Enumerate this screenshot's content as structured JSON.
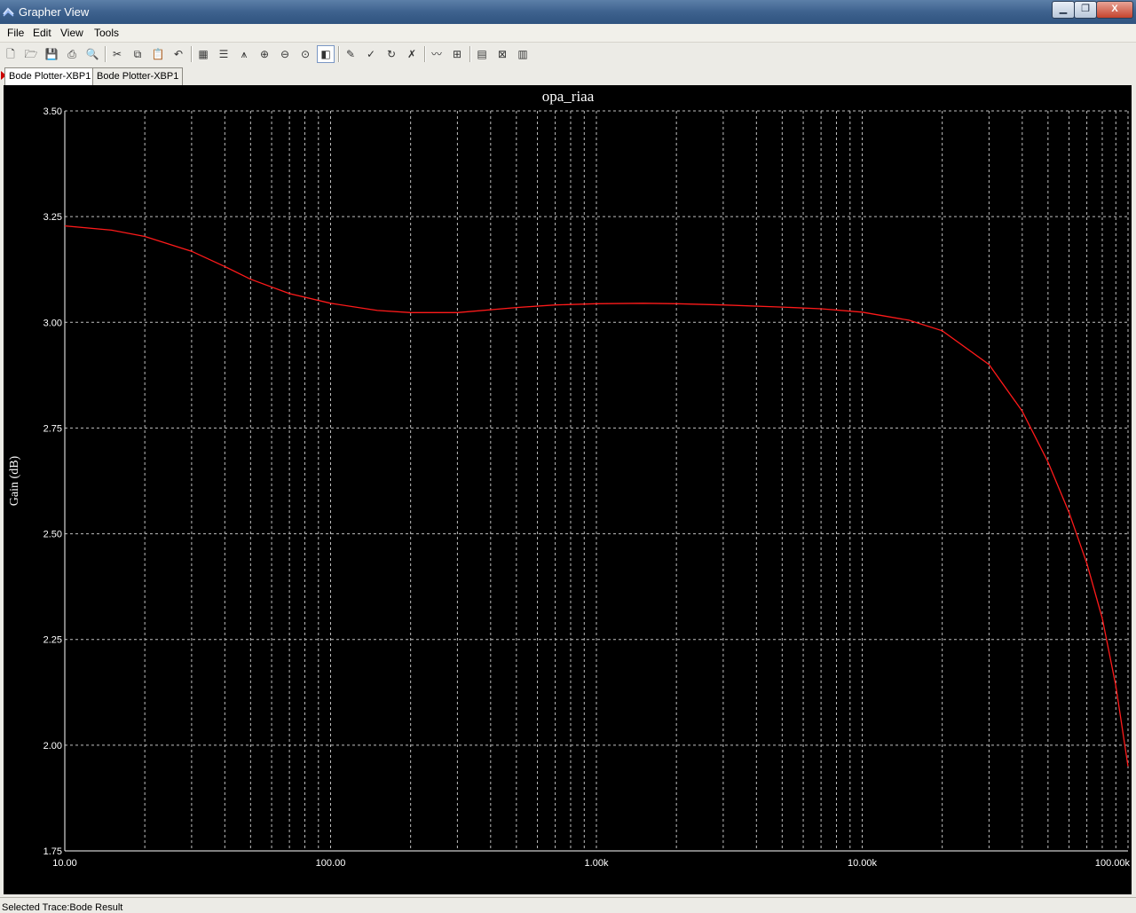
{
  "window": {
    "title": "Grapher View",
    "minimize_label": "▁",
    "maximize_label": "❐",
    "close_label": "X"
  },
  "menu": [
    "File",
    "Edit",
    "View",
    "Tools"
  ],
  "toolbar": [
    {
      "name": "new-icon",
      "glyph": "🗋"
    },
    {
      "name": "open-icon",
      "glyph": "🗁"
    },
    {
      "name": "save-icon",
      "glyph": "💾"
    },
    {
      "name": "print-icon",
      "glyph": "⎙"
    },
    {
      "name": "print-preview-icon",
      "glyph": "🔍"
    },
    {
      "name": "sep"
    },
    {
      "name": "cut-icon",
      "glyph": "✂"
    },
    {
      "name": "copy-icon",
      "glyph": "⧉"
    },
    {
      "name": "paste-icon",
      "glyph": "📋"
    },
    {
      "name": "undo-icon",
      "glyph": "↶"
    },
    {
      "name": "sep"
    },
    {
      "name": "toggle-grid-icon",
      "glyph": "▦"
    },
    {
      "name": "toggle-legend-icon",
      "glyph": "☰"
    },
    {
      "name": "toggle-cursors-icon",
      "glyph": "⩚"
    },
    {
      "name": "zoom-in-icon",
      "glyph": "⊕"
    },
    {
      "name": "zoom-out-icon",
      "glyph": "⊖"
    },
    {
      "name": "zoom-full-icon",
      "glyph": "⊙"
    },
    {
      "name": "reverse-colors-icon",
      "glyph": "◧",
      "pressed": true
    },
    {
      "name": "sep"
    },
    {
      "name": "properties-icon",
      "glyph": "✎"
    },
    {
      "name": "trace-icon",
      "glyph": "✓"
    },
    {
      "name": "reflect-icon",
      "glyph": "↻"
    },
    {
      "name": "pick-icon",
      "glyph": "✗"
    },
    {
      "name": "sep"
    },
    {
      "name": "add-trace-icon",
      "glyph": "〰"
    },
    {
      "name": "overlay-traces-icon",
      "glyph": "⊞"
    },
    {
      "name": "sep"
    },
    {
      "name": "export-excel-icon",
      "glyph": "▤"
    },
    {
      "name": "export-mathcad-icon",
      "glyph": "⊠"
    },
    {
      "name": "export-lvm-icon",
      "glyph": "▥"
    }
  ],
  "tabs": [
    {
      "label": "Bode Plotter-XBP1",
      "active": true
    },
    {
      "label": "Bode Plotter-XBP1",
      "active": false
    }
  ],
  "status": {
    "text": "Selected Trace:Bode Result"
  },
  "colors": {
    "background": "#000000",
    "grid": "#bfbfbf",
    "trace": "#ff1a1a",
    "text": "#ffffff"
  },
  "chart_data": {
    "type": "line",
    "title": "opa_riaa",
    "xlabel": "",
    "ylabel": "Gain (dB)",
    "xscale": "log",
    "xlim": [
      10,
      100000
    ],
    "ylim": [
      1.75,
      3.5
    ],
    "grid": true,
    "x_tick_labels": [
      "10.00",
      "100.00",
      "1.00k",
      "10.00k",
      "100.00k"
    ],
    "y_tick_labels": [
      "3.50",
      "3.25",
      "3.00",
      "2.75",
      "2.50",
      "2.25",
      "2.00",
      "1.75"
    ],
    "series": [
      {
        "color": "#ff1a1a",
        "x": [
          10,
          15,
          20,
          30,
          40,
          50,
          70,
          100,
          150,
          200,
          300,
          500,
          700,
          1000,
          1500,
          2000,
          3000,
          5000,
          7000,
          10000,
          15000,
          20000,
          30000,
          40000,
          50000,
          60000,
          70000,
          80000,
          90000,
          100000
        ],
        "y": [
          3.228,
          3.218,
          3.203,
          3.168,
          3.132,
          3.102,
          3.068,
          3.045,
          3.028,
          3.023,
          3.023,
          3.035,
          3.041,
          3.044,
          3.045,
          3.044,
          3.041,
          3.036,
          3.032,
          3.024,
          3.005,
          2.98,
          2.9,
          2.79,
          2.67,
          2.55,
          2.43,
          2.3,
          2.14,
          1.95
        ]
      }
    ]
  }
}
